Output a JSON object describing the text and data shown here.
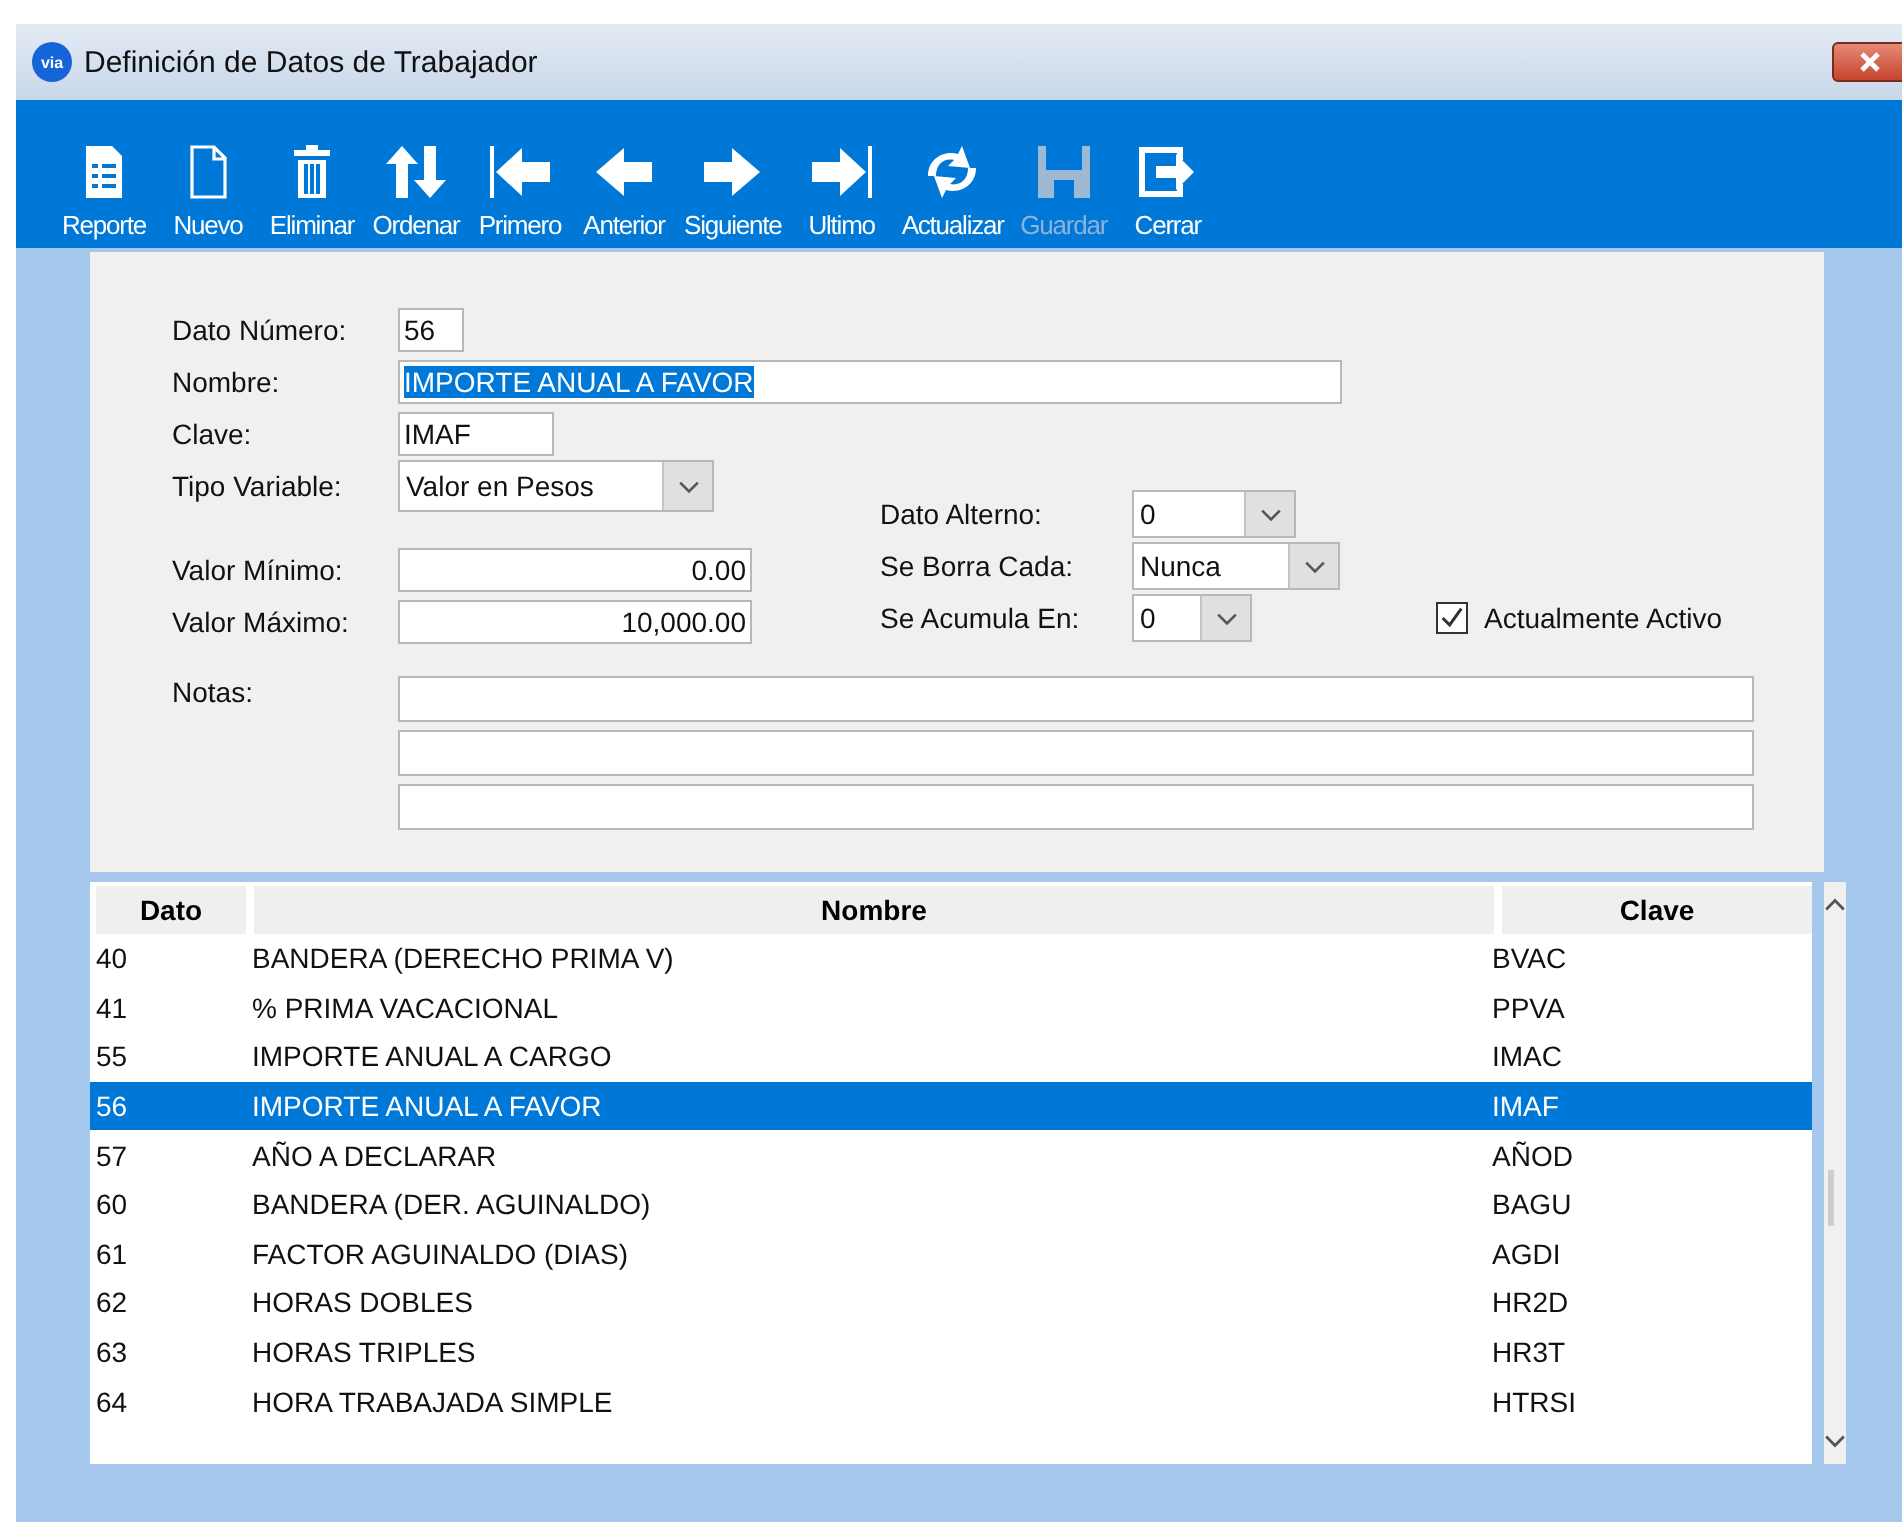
{
  "window": {
    "title": "Definición de Datos de Trabajador",
    "logo_text": "via"
  },
  "toolbar": [
    {
      "label": "Reporte",
      "kind": "report",
      "disabled": false
    },
    {
      "label": "Nuevo",
      "kind": "new",
      "disabled": false
    },
    {
      "label": "Eliminar",
      "kind": "delete",
      "disabled": false
    },
    {
      "label": "Ordenar",
      "kind": "sort",
      "disabled": false
    },
    {
      "label": "Primero",
      "kind": "first",
      "disabled": false
    },
    {
      "label": "Anterior",
      "kind": "prev",
      "disabled": false
    },
    {
      "label": "Siguiente",
      "kind": "next",
      "disabled": false
    },
    {
      "label": "Ultimo",
      "kind": "last",
      "disabled": false
    },
    {
      "label": "Actualizar",
      "kind": "refresh",
      "disabled": false
    },
    {
      "label": "Guardar",
      "kind": "save",
      "disabled": true
    },
    {
      "label": "Cerrar",
      "kind": "exit",
      "disabled": false
    }
  ],
  "form": {
    "dato_numero": {
      "label": "Dato Número:",
      "value": "56"
    },
    "nombre": {
      "label": "Nombre:",
      "value": "IMPORTE ANUAL A FAVOR",
      "text_selected": true
    },
    "clave": {
      "label": "Clave:",
      "value": "IMAF"
    },
    "tipo_variable": {
      "label": "Tipo Variable:",
      "value": "Valor en Pesos"
    },
    "valor_minimo": {
      "label": "Valor Mínimo:",
      "value": "0.00"
    },
    "valor_maximo": {
      "label": "Valor Máximo:",
      "value": "10,000.00"
    },
    "dato_alterno": {
      "label": "Dato Alterno:",
      "value": "0"
    },
    "se_borra_cada": {
      "label": "Se Borra Cada:",
      "value": "Nunca"
    },
    "se_acumula_en": {
      "label": "Se Acumula En:",
      "value": "0"
    },
    "actualmente_activo": {
      "label": "Actualmente Activo",
      "checked": true
    },
    "notas": {
      "label": "Notas:"
    }
  },
  "table": {
    "columns": [
      "Dato",
      "Nombre",
      "Clave"
    ],
    "rows": [
      {
        "cells": [
          "40",
          "BANDERA (DERECHO PRIMA V)",
          "BVAC"
        ],
        "selected": false
      },
      {
        "cells": [
          "41",
          "% PRIMA VACACIONAL",
          "PPVA"
        ],
        "selected": false
      },
      {
        "cells": [
          "55",
          "IMPORTE ANUAL A CARGO",
          "IMAC"
        ],
        "selected": false
      },
      {
        "cells": [
          "56",
          "IMPORTE ANUAL A FAVOR",
          "IMAF"
        ],
        "selected": true
      },
      {
        "cells": [
          "57",
          "AÑO A DECLARAR",
          "AÑOD"
        ],
        "selected": false
      },
      {
        "cells": [
          "60",
          "BANDERA (DER. AGUINALDO)",
          "BAGU"
        ],
        "selected": false
      },
      {
        "cells": [
          "61",
          "FACTOR AGUINALDO (DIAS)",
          "AGDI"
        ],
        "selected": false
      },
      {
        "cells": [
          "62",
          "HORAS DOBLES",
          "HR2D"
        ],
        "selected": false
      },
      {
        "cells": [
          "63",
          "HORAS TRIPLES",
          "HR3T"
        ],
        "selected": false
      },
      {
        "cells": [
          "64",
          "HORA TRABAJADA SIMPLE",
          "HTRSI"
        ],
        "selected": false
      }
    ]
  }
}
